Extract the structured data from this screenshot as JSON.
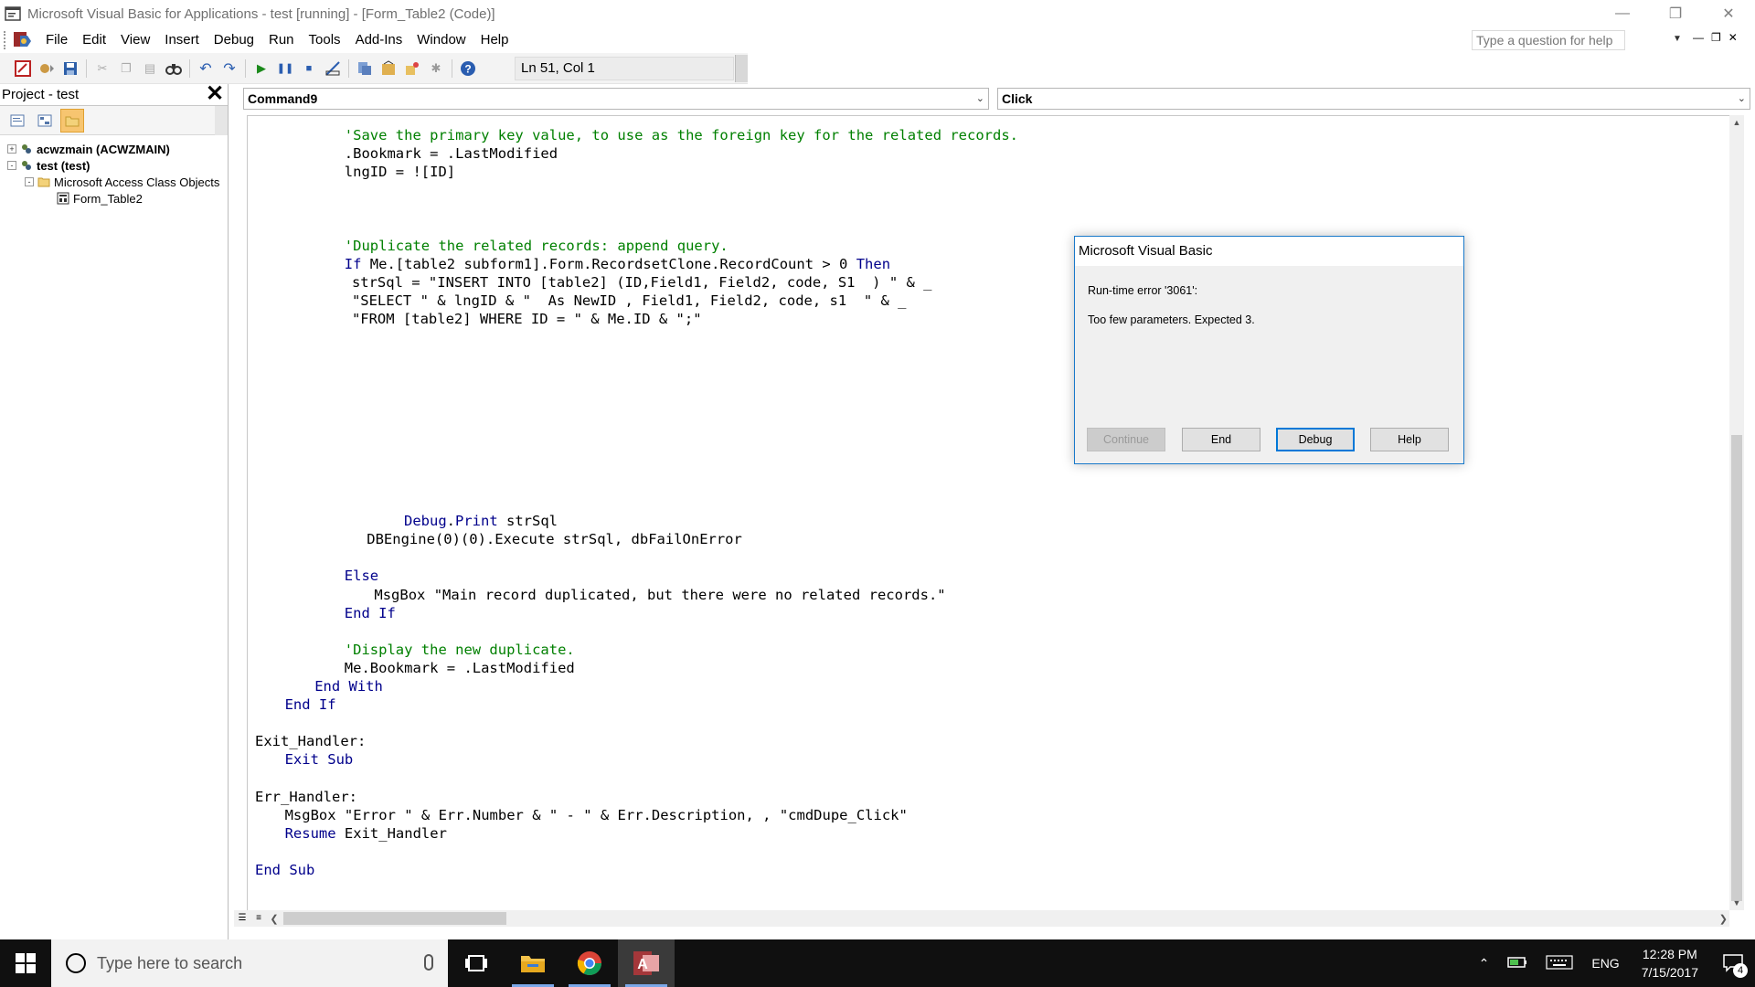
{
  "window": {
    "title": "Microsoft Visual Basic for Applications - test [running] - [Form_Table2 (Code)]",
    "controls": [
      "minimize-icon",
      "restore-icon",
      "close-icon"
    ]
  },
  "menu": {
    "items": [
      {
        "key": "F",
        "label": "File"
      },
      {
        "key": "E",
        "label": "Edit"
      },
      {
        "key": "V",
        "label": "View"
      },
      {
        "key": "I",
        "label": "Insert"
      },
      {
        "key": "D",
        "label": "Debug"
      },
      {
        "key": "R",
        "label": "Run"
      },
      {
        "key": "T",
        "label": "Tools"
      },
      {
        "key": "A",
        "label": "Add-Ins"
      },
      {
        "key": "W",
        "label": "Window"
      },
      {
        "key": "H",
        "label": "Help"
      }
    ],
    "help_placeholder": "Type a question for help"
  },
  "toolbar": {
    "position": "Ln 51, Col 1"
  },
  "project": {
    "title": "Project - test",
    "tree": [
      {
        "label": "acwzmain (ACWZMAIN)",
        "level": 0,
        "bold": true,
        "toggle": "+"
      },
      {
        "label": "test (test)",
        "level": 0,
        "bold": true,
        "toggle": "-"
      },
      {
        "label": "Microsoft Access Class Objects",
        "level": 1,
        "bold": false,
        "toggle": "-"
      },
      {
        "label": "Form_Table2",
        "level": 2,
        "bold": false,
        "toggle": ""
      }
    ]
  },
  "code": {
    "object_combo": "Command9",
    "procedure_combo": "Click",
    "lines": [
      {
        "row": 0,
        "indent": 12,
        "parts": [
          {
            "t": "'Save the primary key value, to use as the foreign key for the related records.",
            "c": "cmt"
          }
        ]
      },
      {
        "row": 1,
        "indent": 12,
        "parts": [
          {
            "t": ".Bookmark = .LastModified",
            "c": ""
          }
        ]
      },
      {
        "row": 2,
        "indent": 12,
        "parts": [
          {
            "t": "lngID = ![ID]",
            "c": ""
          }
        ]
      },
      {
        "row": 6,
        "indent": 12,
        "parts": [
          {
            "t": "'Duplicate the related records: append query.",
            "c": "cmt"
          }
        ]
      },
      {
        "row": 7,
        "indent": 12,
        "parts": [
          {
            "t": "If",
            "c": "kw"
          },
          {
            "t": " Me.[table2 subform1].Form.RecordsetClone.RecordCount > 0 ",
            "c": ""
          },
          {
            "t": "Then",
            "c": "kw"
          }
        ]
      },
      {
        "row": 8,
        "indent": 13,
        "parts": [
          {
            "t": "strSql = \"INSERT INTO [table2] (ID,Field1, Field2, code, S1  ) \" & _",
            "c": ""
          }
        ]
      },
      {
        "row": 9,
        "indent": 13,
        "parts": [
          {
            "t": "\"SELECT \" & lngID & \"  As NewID , Field1, Field2, code, s1  \" & _",
            "c": ""
          }
        ]
      },
      {
        "row": 10,
        "indent": 13,
        "parts": [
          {
            "t": "\"FROM [table2] WHERE ID = \" & Me.ID & \";\"",
            "c": ""
          }
        ]
      },
      {
        "row": 21,
        "indent": 20,
        "parts": [
          {
            "t": "Debug",
            "c": "kw"
          },
          {
            "t": ".",
            "c": ""
          },
          {
            "t": "Print",
            "c": "kw"
          },
          {
            "t": " strSql",
            "c": ""
          }
        ]
      },
      {
        "row": 22,
        "indent": 15,
        "parts": [
          {
            "t": "DBEngine(0)(0).Execute strSql, dbFailOnError",
            "c": ""
          }
        ]
      },
      {
        "row": 24,
        "indent": 12,
        "parts": [
          {
            "t": "Else",
            "c": "kw"
          }
        ]
      },
      {
        "row": 25,
        "indent": 16,
        "parts": [
          {
            "t": "MsgBox \"Main record duplicated, but there were no related records.\"",
            "c": ""
          }
        ]
      },
      {
        "row": 26,
        "indent": 12,
        "parts": [
          {
            "t": "End If",
            "c": "kw"
          }
        ]
      },
      {
        "row": 28,
        "indent": 12,
        "parts": [
          {
            "t": "'Display the new duplicate.",
            "c": "cmt"
          }
        ]
      },
      {
        "row": 29,
        "indent": 12,
        "parts": [
          {
            "t": "Me.Bookmark = .LastModified",
            "c": ""
          }
        ]
      },
      {
        "row": 30,
        "indent": 8,
        "parts": [
          {
            "t": "End With",
            "c": "kw"
          }
        ]
      },
      {
        "row": 31,
        "indent": 4,
        "parts": [
          {
            "t": "End If",
            "c": "kw"
          }
        ]
      },
      {
        "row": 33,
        "indent": 0,
        "parts": [
          {
            "t": "Exit_Handler:",
            "c": ""
          }
        ]
      },
      {
        "row": 34,
        "indent": 4,
        "parts": [
          {
            "t": "Exit Sub",
            "c": "kw"
          }
        ]
      },
      {
        "row": 36,
        "indent": 0,
        "parts": [
          {
            "t": "Err_Handler:",
            "c": ""
          }
        ]
      },
      {
        "row": 37,
        "indent": 4,
        "parts": [
          {
            "t": "MsgBox \"Error \" & Err.Number & \" - \" & Err.Description, , \"cmdDupe_Click\"",
            "c": ""
          }
        ]
      },
      {
        "row": 38,
        "indent": 4,
        "parts": [
          {
            "t": "Resume",
            "c": "kw"
          },
          {
            "t": " Exit_Handler",
            "c": ""
          }
        ]
      },
      {
        "row": 40,
        "indent": 0,
        "parts": [
          {
            "t": "End Sub",
            "c": "kw"
          }
        ]
      }
    ]
  },
  "dialog": {
    "title": "Microsoft Visual Basic",
    "error": "Run-time error '3061':",
    "message": "Too few parameters. Expected 3.",
    "buttons": {
      "continue": "Continue",
      "end": "End",
      "debug": "Debug",
      "help": "Help"
    }
  },
  "taskbar": {
    "search_placeholder": "Type here to search",
    "language": "ENG",
    "time": "12:28 PM",
    "date": "7/15/2017",
    "notification_count": "4"
  }
}
